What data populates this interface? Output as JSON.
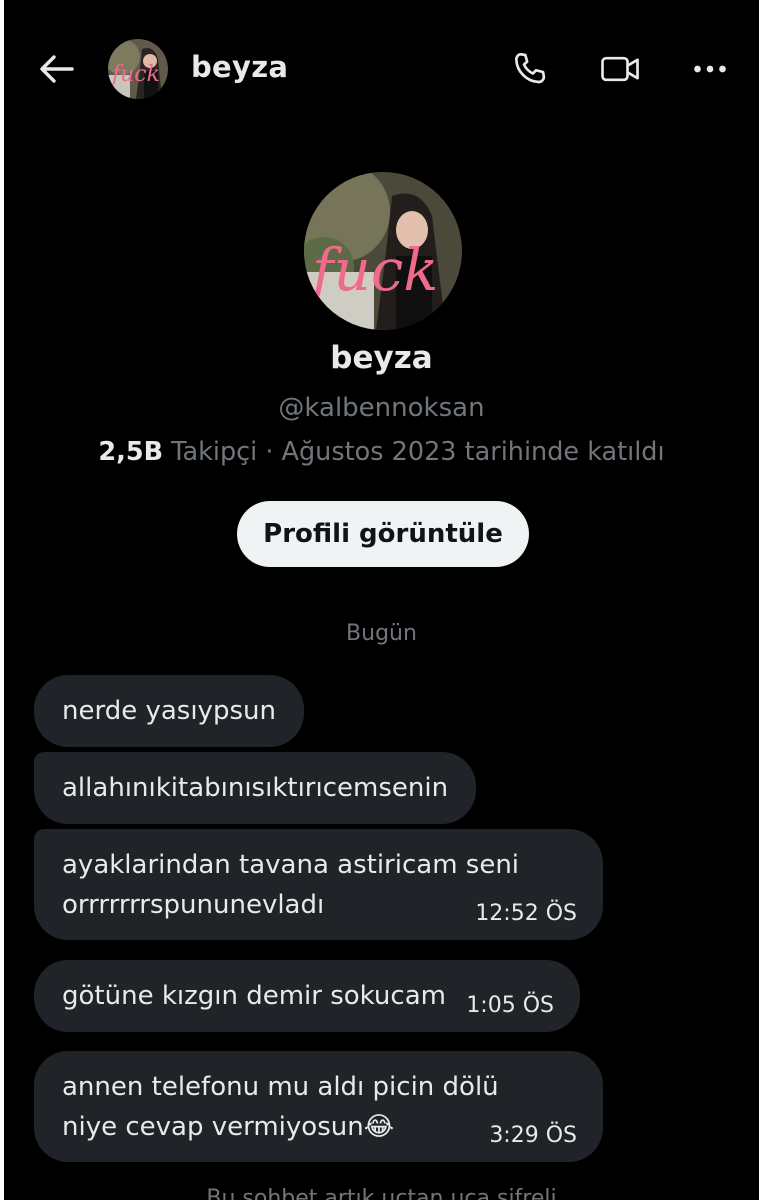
{
  "header": {
    "back_icon": "arrow-left-icon",
    "name": "beyza",
    "call_icon": "phone-icon",
    "video_icon": "video-camera-icon",
    "more_icon": "more-horizontal-icon"
  },
  "profile": {
    "name": "beyza",
    "handle": "@kalbennoksan",
    "followers_count": "2,5B",
    "followers_label": " Takipçi · Ağustos 2023 tarihinde katıldı",
    "view_profile_button": "Profili görüntüle",
    "avatar_overlay_text": "fuck"
  },
  "day_separator": "Bugün",
  "messages": [
    {
      "text": "nerde yasıypsun",
      "time": ""
    },
    {
      "text": "allahınıkitabınısıktırıcemsenin",
      "time": ""
    },
    {
      "line1": "ayaklarindan tavana astiricam seni",
      "line2": "orrrrrrrspununevladı",
      "time": "12:52 ÖS"
    },
    {
      "text": "götüne kızgın demir sokucam",
      "time": "1:05 ÖS"
    },
    {
      "line1": "annen telefonu mu aldı picin dölü",
      "line2": "niye cevap vermiyosun😂",
      "time": "3:29 ÖS"
    }
  ],
  "footer_note": "Bu sohbet artık uçtan uca şifreli",
  "colors": {
    "background": "#000000",
    "bubble": "#202327",
    "primary_text": "#e7e9ea",
    "secondary_text": "#71767b",
    "button_bg": "#eff3f4"
  }
}
